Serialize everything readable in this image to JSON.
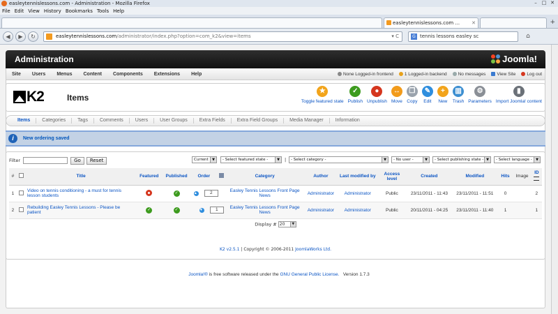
{
  "browser": {
    "window_title": "easleytennislessons.com - Administration - Mozilla Firefox",
    "menu": [
      "File",
      "Edit",
      "View",
      "History",
      "Bookmarks",
      "Tools",
      "Help"
    ],
    "active_tab_title": "easleytennislessons.com ...",
    "url_host": "easleytennislessons.com",
    "url_path": "/administrator/index.php?option=com_k2&view=items",
    "search_text": "tennis lessons easley sc"
  },
  "admin": {
    "header_title": "Administration",
    "joomla_brand": "Joomla!",
    "top_menu": [
      "Site",
      "Users",
      "Menus",
      "Content",
      "Components",
      "Extensions",
      "Help"
    ],
    "status": {
      "frontend": "None Logged-in frontend",
      "backend": "1 Logged-in backend",
      "messages": "No messages",
      "view_site": "View Site",
      "logout": "Log out"
    }
  },
  "k2": {
    "logo_text": "K2",
    "page_title": "Items",
    "toolbar": [
      {
        "label": "Toggle featured state",
        "icon": "star-icon",
        "color": "#f2a41b",
        "glyph": "★"
      },
      {
        "label": "Publish",
        "icon": "publish-icon",
        "color": "#3d9b1e",
        "glyph": "✓"
      },
      {
        "label": "Unpublish",
        "icon": "unpublish-icon",
        "color": "#d5361e",
        "glyph": "●"
      },
      {
        "label": "Move",
        "icon": "move-icon",
        "color": "#f29b1b",
        "glyph": "↔"
      },
      {
        "label": "Copy",
        "icon": "copy-icon",
        "color": "#9aa3ad",
        "glyph": "❐"
      },
      {
        "label": "Edit",
        "icon": "edit-icon",
        "color": "#2f8ede",
        "glyph": "✎"
      },
      {
        "label": "New",
        "icon": "new-icon",
        "color": "#f2a41b",
        "glyph": "+"
      },
      {
        "label": "Trash",
        "icon": "trash-icon",
        "color": "#3d8fd1",
        "glyph": "▥"
      },
      {
        "label": "Parameters",
        "icon": "parameters-icon",
        "color": "#8a8f96",
        "glyph": "⚙"
      },
      {
        "label": "Import Joomla! content",
        "icon": "import-icon",
        "color": "#6b7178",
        "glyph": "▮"
      }
    ],
    "subnav": [
      "Items",
      "Categories",
      "Tags",
      "Comments",
      "Users",
      "User Groups",
      "Extra Fields",
      "Extra Field Groups",
      "Media Manager",
      "Information"
    ],
    "message": "New ordering saved",
    "filter": {
      "label": "Filter",
      "value": "",
      "go": "Go",
      "reset": "Reset",
      "current": "Current",
      "featured": "- Select featured state -",
      "category": "- Select category -",
      "user": "- No user -",
      "publishing": "- Select publishing state -",
      "language": "- Select language -"
    },
    "columns": {
      "num": "#",
      "title": "Title",
      "featured": "Featured",
      "published": "Published",
      "order": "Order",
      "category": "Category",
      "author": "Author",
      "last_modified_by": "Last modified by",
      "access": "Access level",
      "created": "Created",
      "modified": "Modified",
      "hits": "Hits",
      "image": "Image",
      "id": "ID"
    },
    "rows": [
      {
        "num": "1",
        "title": "Video on tennis conditioning - a must for tennis lesson students",
        "featured": false,
        "published": true,
        "order": "2",
        "category": "Easley Tennis Lessons Front Page News",
        "author": "Administrator",
        "modified_by": "Administrator",
        "access": "Public",
        "created": "23/11/2011 - 11:43",
        "modified": "23/11/2011 - 11:51",
        "hits": "0",
        "image": "",
        "id": "2"
      },
      {
        "num": "2",
        "title": "Rebuilding Easley Tennis Lessons - Please be patient",
        "featured": true,
        "published": true,
        "order": "1",
        "category": "Easley Tennis Lessons Front Page News",
        "author": "Administrator",
        "modified_by": "Administrator",
        "access": "Public",
        "created": "20/11/2011 - 04:25",
        "modified": "23/11/2011 - 11:40",
        "hits": "1",
        "image": "",
        "id": "1"
      }
    ],
    "display_label": "Display #",
    "display_value": "20",
    "k2_version": "K2 v2.5.1",
    "copyright_text": "| Copyright © 2006-2011",
    "copyright_link": "JoomlaWorks Ltd."
  },
  "page_footer": {
    "joomla_link": "Joomla!®",
    "text": "is free software released under the",
    "license_link": "GNU General Public License.",
    "version": "Version 1.7.3"
  }
}
